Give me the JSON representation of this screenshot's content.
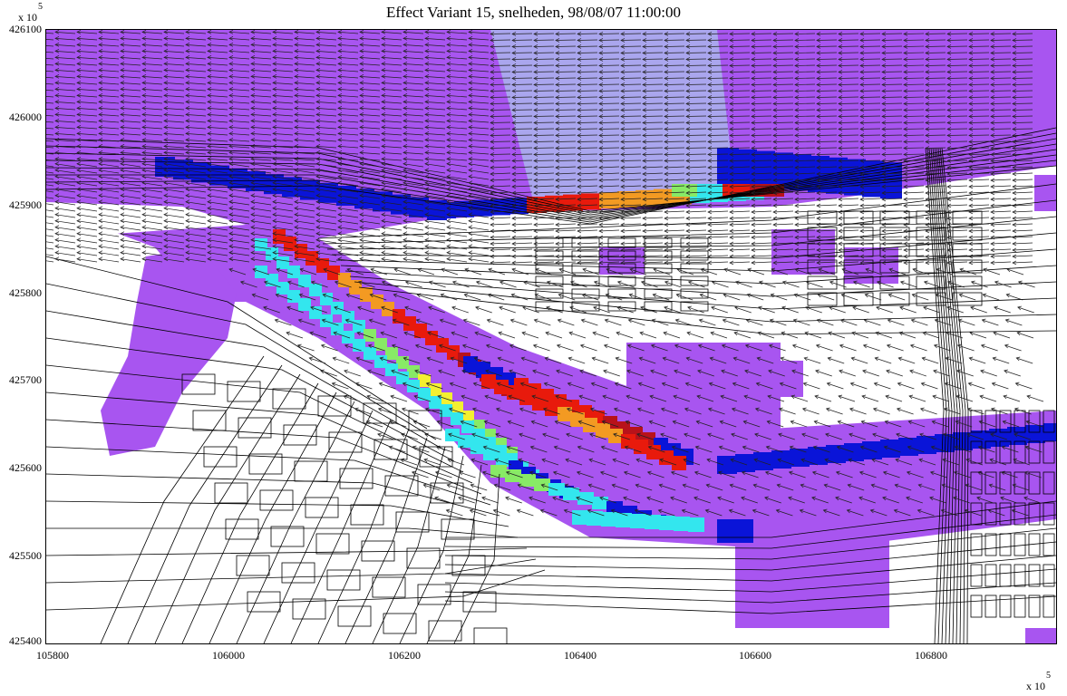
{
  "title": "Effect Variant 15, snelheden, 98/08/07 11:00:00",
  "y_axis": {
    "multiplier_base": "x 10",
    "multiplier_exponent": "5",
    "ticks": [
      "426100",
      "426000",
      "425900",
      "425800",
      "425700",
      "425600",
      "425500",
      "425400"
    ]
  },
  "x_axis": {
    "multiplier_base": "x 10",
    "multiplier_exponent": "5",
    "ticks": [
      "105800",
      "106000",
      "106200",
      "106400",
      "106600",
      "106800"
    ]
  },
  "map": {
    "x_range": [
      105800,
      106950
    ],
    "y_range": [
      425400,
      426100
    ],
    "colors": {
      "water_background": "#a855f0",
      "water_light": "#aaa6ee",
      "land": "#ffffff",
      "lines": "#000000",
      "deep_blue": "#0a14d8",
      "cyan": "#33e6ee",
      "green": "#88ea66",
      "yellow": "#f3f031",
      "orange": "#f39a22",
      "red": "#e81a0c",
      "dark_red": "#b8121a"
    },
    "vector_field": "velocity arrows pointing generally to the left / upstream"
  }
}
